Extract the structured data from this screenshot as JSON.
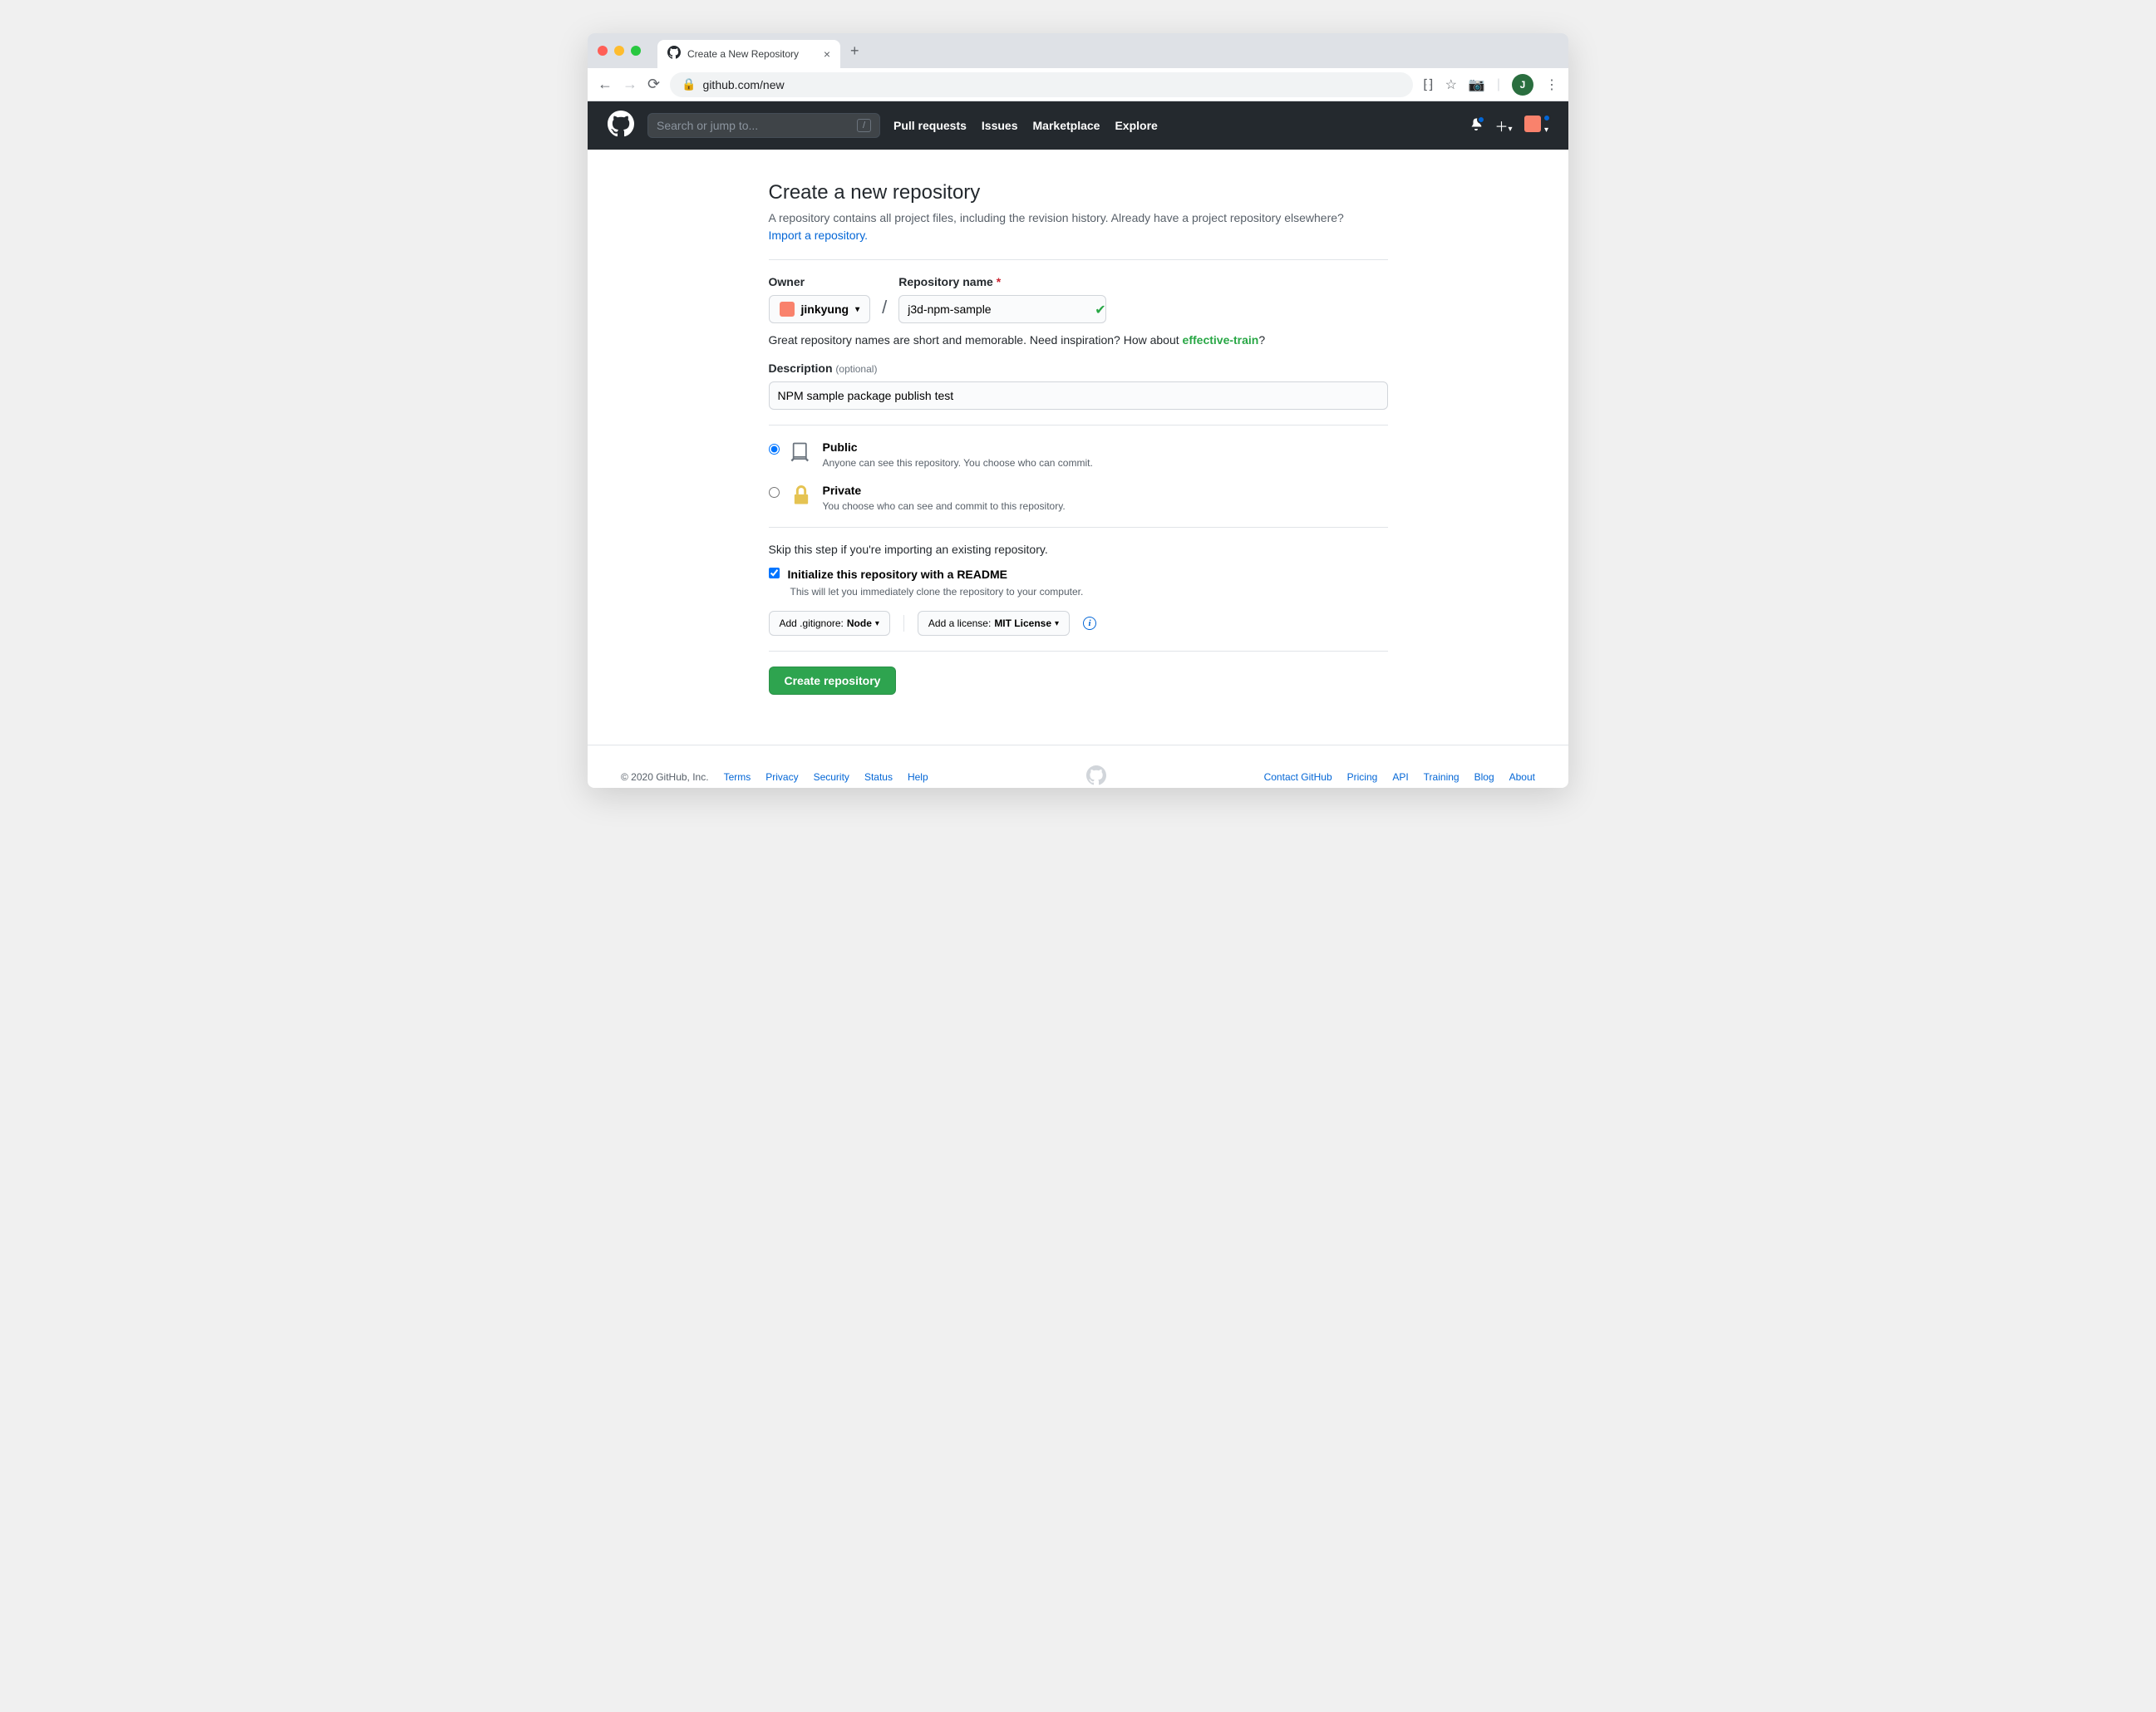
{
  "browser": {
    "tab_title": "Create a New Repository",
    "url": "github.com/new",
    "avatar_initial": "J"
  },
  "header": {
    "search_placeholder": "Search or jump to...",
    "nav": [
      "Pull requests",
      "Issues",
      "Marketplace",
      "Explore"
    ]
  },
  "page": {
    "title": "Create a new repository",
    "subtitle_1": "A repository contains all project files, including the revision history. Already have a project repository elsewhere?",
    "import_link": "Import a repository.",
    "owner_label": "Owner",
    "owner_value": "jinkyung",
    "repo_label": "Repository name",
    "repo_value": "j3d-npm-sample",
    "hint_prefix": "Great repository names are short and memorable. Need inspiration? How about ",
    "suggestion": "effective-train",
    "desc_label": "Description",
    "optional": "(optional)",
    "desc_value": "NPM sample package publish test",
    "public_label": "Public",
    "public_desc": "Anyone can see this repository. You choose who can commit.",
    "private_label": "Private",
    "private_desc": "You choose who can see and commit to this repository.",
    "skip_text": "Skip this step if you're importing an existing repository.",
    "readme_label": "Initialize this repository with a README",
    "readme_desc": "This will let you immediately clone the repository to your computer.",
    "gitignore_prefix": "Add .gitignore: ",
    "gitignore_value": "Node",
    "license_prefix": "Add a license: ",
    "license_value": "MIT License",
    "submit": "Create repository"
  },
  "footer": {
    "copyright": "© 2020 GitHub, Inc.",
    "left": [
      "Terms",
      "Privacy",
      "Security",
      "Status",
      "Help"
    ],
    "right": [
      "Contact GitHub",
      "Pricing",
      "API",
      "Training",
      "Blog",
      "About"
    ]
  }
}
